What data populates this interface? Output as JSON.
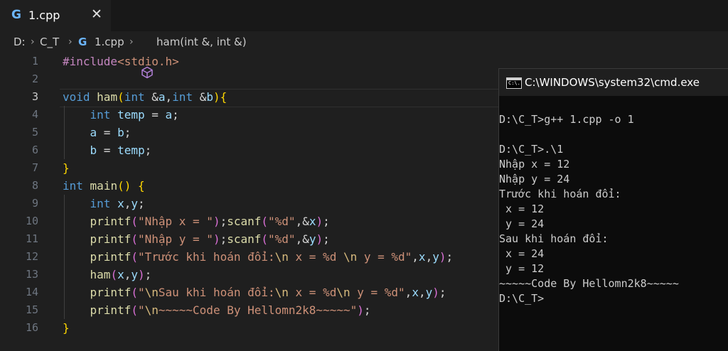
{
  "tab": {
    "file_icon": "c-plus-plus-icon",
    "filename": "1.cpp",
    "close": "✕"
  },
  "breadcrumb": {
    "drive": "D:",
    "folder": "C_T",
    "file": "1.cpp",
    "symbol": "ham(int &, int &)"
  },
  "editor": {
    "active_line": 3,
    "lines": [
      {
        "n": "1",
        "tokens": [
          [
            "pre",
            "#include"
          ],
          [
            "inc",
            "<stdio.h>"
          ]
        ]
      },
      {
        "n": "2",
        "tokens": []
      },
      {
        "n": "3",
        "tokens": [
          [
            "kw",
            "void"
          ],
          [
            "op",
            " "
          ],
          [
            "fn",
            "ham"
          ],
          [
            "p1",
            "("
          ],
          [
            "kw",
            "int"
          ],
          [
            "op",
            " &"
          ],
          [
            "var",
            "a"
          ],
          [
            "op",
            ","
          ],
          [
            "kw",
            "int"
          ],
          [
            "op",
            " &"
          ],
          [
            "var",
            "b"
          ],
          [
            "p1",
            ")"
          ],
          [
            "p1",
            "{"
          ]
        ]
      },
      {
        "n": "4",
        "tokens": [
          [
            "op",
            "    "
          ],
          [
            "kw",
            "int"
          ],
          [
            "op",
            " "
          ],
          [
            "var",
            "temp"
          ],
          [
            "op",
            " = "
          ],
          [
            "var",
            "a"
          ],
          [
            "op",
            ";"
          ]
        ]
      },
      {
        "n": "5",
        "tokens": [
          [
            "op",
            "    "
          ],
          [
            "var",
            "a"
          ],
          [
            "op",
            " = "
          ],
          [
            "var",
            "b"
          ],
          [
            "op",
            ";"
          ]
        ]
      },
      {
        "n": "6",
        "tokens": [
          [
            "op",
            "    "
          ],
          [
            "var",
            "b"
          ],
          [
            "op",
            " = "
          ],
          [
            "var",
            "temp"
          ],
          [
            "op",
            ";"
          ]
        ]
      },
      {
        "n": "7",
        "tokens": [
          [
            "p1",
            "}"
          ]
        ]
      },
      {
        "n": "8",
        "tokens": [
          [
            "kw",
            "int"
          ],
          [
            "op",
            " "
          ],
          [
            "fn",
            "main"
          ],
          [
            "p1",
            "()"
          ],
          [
            "op",
            " "
          ],
          [
            "p1",
            "{"
          ]
        ]
      },
      {
        "n": "9",
        "tokens": [
          [
            "op",
            "    "
          ],
          [
            "kw",
            "int"
          ],
          [
            "op",
            " "
          ],
          [
            "var",
            "x"
          ],
          [
            "op",
            ","
          ],
          [
            "var",
            "y"
          ],
          [
            "op",
            ";"
          ]
        ]
      },
      {
        "n": "10",
        "tokens": [
          [
            "op",
            "    "
          ],
          [
            "fn",
            "printf"
          ],
          [
            "p2",
            "("
          ],
          [
            "str",
            "\"Nhập x = \""
          ],
          [
            "p2",
            ")"
          ],
          [
            "op",
            ";"
          ],
          [
            "fn",
            "scanf"
          ],
          [
            "p2",
            "("
          ],
          [
            "str",
            "\"%d\""
          ],
          [
            "op",
            ",&"
          ],
          [
            "var",
            "x"
          ],
          [
            "p2",
            ")"
          ],
          [
            "op",
            ";"
          ]
        ]
      },
      {
        "n": "11",
        "tokens": [
          [
            "op",
            "    "
          ],
          [
            "fn",
            "printf"
          ],
          [
            "p2",
            "("
          ],
          [
            "str",
            "\"Nhập y = \""
          ],
          [
            "p2",
            ")"
          ],
          [
            "op",
            ";"
          ],
          [
            "fn",
            "scanf"
          ],
          [
            "p2",
            "("
          ],
          [
            "str",
            "\"%d\""
          ],
          [
            "op",
            ",&"
          ],
          [
            "var",
            "y"
          ],
          [
            "p2",
            ")"
          ],
          [
            "op",
            ";"
          ]
        ]
      },
      {
        "n": "12",
        "tokens": [
          [
            "op",
            "    "
          ],
          [
            "fn",
            "printf"
          ],
          [
            "p2",
            "("
          ],
          [
            "str",
            "\"Trước khi hoán đổi:"
          ],
          [
            "esc",
            "\\n"
          ],
          [
            "str",
            " x = %d "
          ],
          [
            "esc",
            "\\n"
          ],
          [
            "str",
            " y = %d\""
          ],
          [
            "op",
            ","
          ],
          [
            "var",
            "x"
          ],
          [
            "op",
            ","
          ],
          [
            "var",
            "y"
          ],
          [
            "p2",
            ")"
          ],
          [
            "op",
            ";"
          ]
        ]
      },
      {
        "n": "13",
        "tokens": [
          [
            "op",
            "    "
          ],
          [
            "fn",
            "ham"
          ],
          [
            "p2",
            "("
          ],
          [
            "var",
            "x"
          ],
          [
            "op",
            ","
          ],
          [
            "var",
            "y"
          ],
          [
            "p2",
            ")"
          ],
          [
            "op",
            ";"
          ]
        ]
      },
      {
        "n": "14",
        "tokens": [
          [
            "op",
            "    "
          ],
          [
            "fn",
            "printf"
          ],
          [
            "p2",
            "("
          ],
          [
            "str",
            "\""
          ],
          [
            "esc",
            "\\n"
          ],
          [
            "str",
            "Sau khi hoán đổi:"
          ],
          [
            "esc",
            "\\n"
          ],
          [
            "str",
            " x = %d"
          ],
          [
            "esc",
            "\\n"
          ],
          [
            "str",
            " y = %d\""
          ],
          [
            "op",
            ","
          ],
          [
            "var",
            "x"
          ],
          [
            "op",
            ","
          ],
          [
            "var",
            "y"
          ],
          [
            "p2",
            ")"
          ],
          [
            "op",
            ";"
          ]
        ]
      },
      {
        "n": "15",
        "tokens": [
          [
            "op",
            "    "
          ],
          [
            "fn",
            "printf"
          ],
          [
            "p2",
            "("
          ],
          [
            "str",
            "\""
          ],
          [
            "esc",
            "\\n"
          ],
          [
            "str",
            "~~~~~Code By Hellomn2k8~~~~~\""
          ],
          [
            "p2",
            ")"
          ],
          [
            "op",
            ";"
          ]
        ]
      },
      {
        "n": "16",
        "tokens": [
          [
            "p1",
            "}"
          ]
        ]
      }
    ]
  },
  "terminal": {
    "title": "C:\\WINDOWS\\system32\\cmd.exe",
    "icon": "cmd-window-icon",
    "icon_text": "C:\\.",
    "lines": [
      "",
      "D:\\C_T>g++ 1.cpp -o 1",
      "",
      "D:\\C_T>.\\1",
      "Nhập x = 12",
      "Nhập y = 24",
      "Trước khi hoán đổi:",
      " x = 12",
      " y = 24",
      "Sau khi hoán đổi:",
      " x = 24",
      " y = 12",
      "~~~~~Code By Hellomn2k8~~~~~",
      "D:\\C_T>"
    ]
  }
}
